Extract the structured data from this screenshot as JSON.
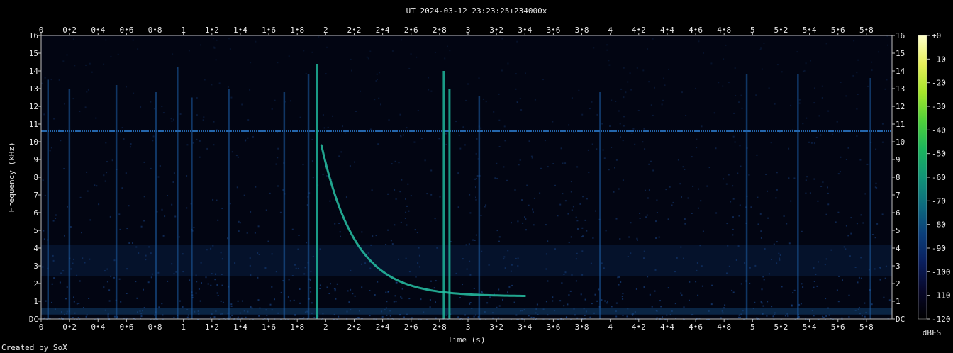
{
  "chart_data": {
    "type": "heatmap",
    "title": "UT 2024-03-12 23:23:25+234000x",
    "xlabel": "Time (s)",
    "ylabel": "Frequency (kHz)",
    "xlim": [
      0,
      5.98
    ],
    "ylim": [
      0,
      16
    ],
    "x_ticks": [
      "0",
      "0•2",
      "0•4",
      "0•6",
      "0•8",
      "1",
      "1•2",
      "1•4",
      "1•6",
      "1•8",
      "2",
      "2•2",
      "2•4",
      "2•6",
      "2•8",
      "3",
      "3•2",
      "3•4",
      "3•6",
      "3•8",
      "4",
      "4•2",
      "4•4",
      "4•6",
      "4•8",
      "5",
      "5•2",
      "5•4",
      "5•6",
      "5•8"
    ],
    "y_ticks": [
      "DC",
      "1",
      "2",
      "3",
      "4",
      "5",
      "6",
      "7",
      "8",
      "9",
      "10",
      "11",
      "12",
      "13",
      "14",
      "15",
      "16"
    ],
    "colorbar": {
      "label": "dBFS",
      "ticks": [
        "+0",
        "-10",
        "-20",
        "-30",
        "-40",
        "-50",
        "-60",
        "-70",
        "-80",
        "-90",
        "-100",
        "-110",
        "-120"
      ],
      "range": [
        -120,
        0
      ],
      "colors": [
        "#000000",
        "#08082a",
        "#0a1f5e",
        "#0b3f7a",
        "#0d6b7e",
        "#119477",
        "#1bb55c",
        "#4fd13a",
        "#a6e62a",
        "#e6ef5a",
        "#ffffc8"
      ]
    },
    "horizontal_line_khz": 10.6,
    "sweep": {
      "t_start": 1.97,
      "t_end": 3.4,
      "f_start_khz": 9.8,
      "f_end_khz": 1.3
    },
    "impulses": [
      {
        "t": 0.05,
        "f_top": 13.5
      },
      {
        "t": 0.2,
        "f_top": 13.0
      },
      {
        "t": 0.53,
        "f_top": 13.2
      },
      {
        "t": 0.81,
        "f_top": 12.8
      },
      {
        "t": 0.96,
        "f_top": 14.2
      },
      {
        "t": 1.06,
        "f_top": 12.5
      },
      {
        "t": 1.32,
        "f_top": 13.0
      },
      {
        "t": 1.71,
        "f_top": 12.8
      },
      {
        "t": 1.88,
        "f_top": 13.8
      },
      {
        "t": 1.94,
        "f_top": 14.4
      },
      {
        "t": 2.83,
        "f_top": 14.0
      },
      {
        "t": 2.87,
        "f_top": 13.0
      },
      {
        "t": 3.08,
        "f_top": 12.6
      },
      {
        "t": 3.93,
        "f_top": 12.8
      },
      {
        "t": 4.96,
        "f_top": 13.8
      },
      {
        "t": 5.32,
        "f_top": 13.8
      },
      {
        "t": 5.83,
        "f_top": 13.6
      }
    ],
    "grid": false,
    "footer": "Created by SoX"
  }
}
